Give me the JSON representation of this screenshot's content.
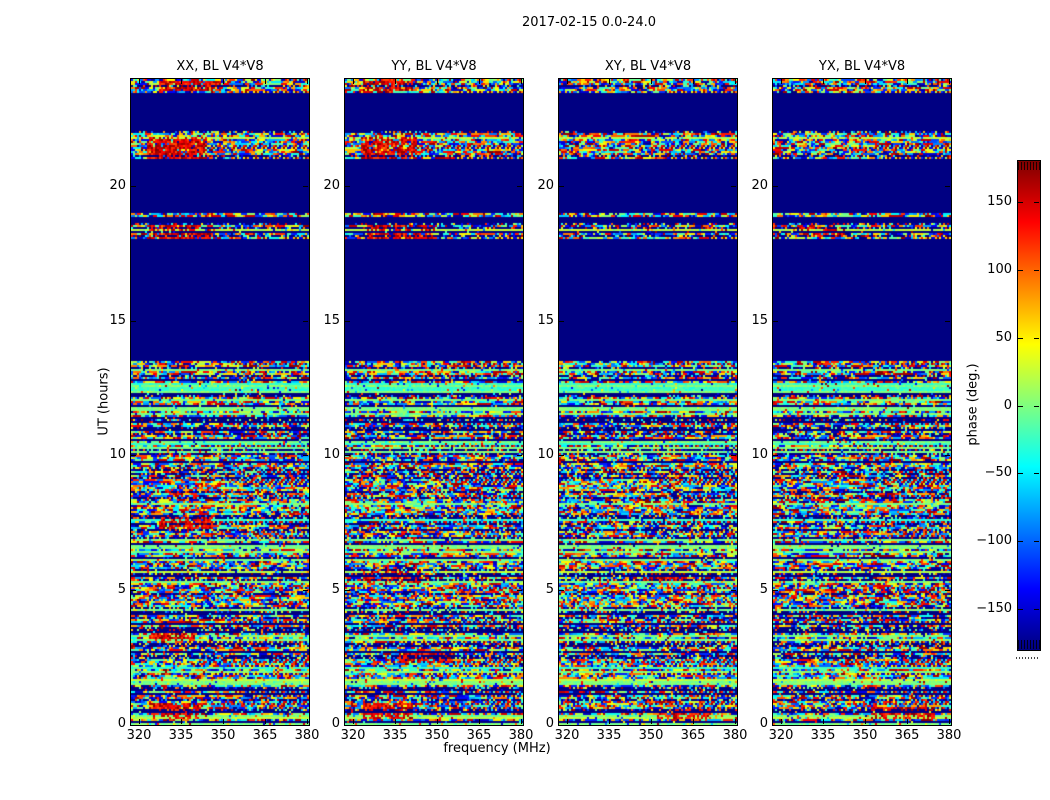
{
  "figure": {
    "title": "2017-02-15 0.0-24.0"
  },
  "chart_data": {
    "type": "heatmap",
    "title": "2017-02-15 0.0-24.0",
    "xlabel": "frequency (MHz)",
    "ylabel": "UT (hours)",
    "xlim": [
      317.1,
      380.7
    ],
    "ylim": [
      0,
      24
    ],
    "x_ticks": [
      320,
      335,
      350,
      365,
      380
    ],
    "y_ticks": [
      0,
      5,
      10,
      15,
      20
    ],
    "grid": false,
    "colormap": "jet",
    "colors": {
      "quiet_phase": "#000082",
      "calm_phase": "#7dff7a",
      "hot_phase": "#d82000"
    },
    "panels": [
      {
        "title": "XX, BL V4*V8",
        "seed": 101,
        "hotspots": [
          {
            "h": [
              23.55,
              23.95
            ],
            "f": [
              0.15,
              0.5
            ]
          },
          {
            "h": [
              21.05,
              21.85
            ],
            "f": [
              0.08,
              0.42
            ]
          },
          {
            "h": [
              18.05,
              18.6
            ],
            "f": [
              0.1,
              0.45
            ]
          },
          {
            "h": [
              7.25,
              7.75
            ],
            "f": [
              0.15,
              0.45
            ]
          },
          {
            "h": [
              3.1,
              3.55
            ],
            "f": [
              0.1,
              0.35
            ]
          },
          {
            "h": [
              0.2,
              0.85
            ],
            "f": [
              0.12,
              0.4
            ]
          }
        ]
      },
      {
        "title": "YY, BL V4*V8",
        "seed": 211,
        "hotspots": [
          {
            "h": [
              23.55,
              23.95
            ],
            "f": [
              0.1,
              0.38
            ]
          },
          {
            "h": [
              21.05,
              21.85
            ],
            "f": [
              0.08,
              0.4
            ]
          },
          {
            "h": [
              18.05,
              18.6
            ],
            "f": [
              0.12,
              0.5
            ]
          },
          {
            "h": [
              5.25,
              5.7
            ],
            "f": [
              0.1,
              0.42
            ]
          },
          {
            "h": [
              2.3,
              2.7
            ],
            "f": [
              0.3,
              0.6
            ]
          },
          {
            "h": [
              0.2,
              0.85
            ],
            "f": [
              0.1,
              0.38
            ]
          }
        ]
      },
      {
        "title": "XY, BL V4*V8",
        "seed": 307,
        "hotspots": [
          {
            "h": [
              5.35,
              5.65
            ],
            "f": [
              0.45,
              0.72
            ]
          },
          {
            "h": [
              0.25,
              0.6
            ],
            "f": [
              0.55,
              0.85
            ]
          }
        ]
      },
      {
        "title": "YX, BL V4*V8",
        "seed": 419,
        "hotspots": [
          {
            "h": [
              18.1,
              18.5
            ],
            "f": [
              0.15,
              0.4
            ]
          },
          {
            "h": [
              0.25,
              0.7
            ],
            "f": [
              0.55,
              0.9
            ]
          }
        ]
      }
    ],
    "active_time_bands": [
      {
        "start_hour": 0.0,
        "end_hour": 13.55
      },
      {
        "start_hour": 18.05,
        "end_hour": 18.65
      },
      {
        "start_hour": 18.85,
        "end_hour": 19.0
      },
      {
        "start_hour": 21.05,
        "end_hour": 21.9
      },
      {
        "start_hour": 21.95,
        "end_hour": 22.1
      },
      {
        "start_hour": 23.5,
        "end_hour": 24.0
      }
    ],
    "row_seed": 7,
    "colorbar": {
      "label": "phase (deg.)",
      "ticks": [
        150,
        100,
        50,
        0,
        -50,
        -100,
        -150
      ],
      "range": [
        -180,
        180
      ],
      "orientation": "vertical"
    }
  }
}
